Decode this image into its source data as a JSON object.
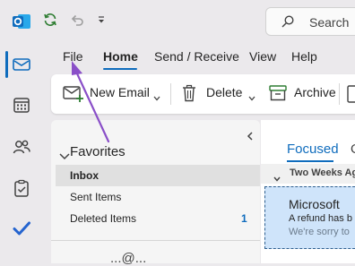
{
  "colors": {
    "accent": "#0f6cbd",
    "outlook_blue": "#0f6cbd",
    "arrow": "#8a4fc8"
  },
  "titlebar": {
    "app_icon": "outlook-icon",
    "search_placeholder": "Search"
  },
  "menu_tabs": [
    "File",
    "Home",
    "Send / Receive",
    "View",
    "Help"
  ],
  "active_tab": "Home",
  "ribbon": {
    "new_email": "New Email",
    "delete": "Delete",
    "archive": "Archive"
  },
  "folders": {
    "section": "Favorites",
    "items": [
      {
        "label": "Inbox",
        "count": ""
      },
      {
        "label": "Sent Items",
        "count": ""
      },
      {
        "label": "Deleted Items",
        "count": "1"
      }
    ],
    "account_partial": "...@..."
  },
  "mail_list": {
    "tab_focused": "Focused",
    "tab_other_partial": "O",
    "group_header": "Two Weeks Ag",
    "items": [
      {
        "sender": "Microsoft",
        "subject": "A refund has b",
        "preview": "We're sorry to"
      }
    ]
  }
}
